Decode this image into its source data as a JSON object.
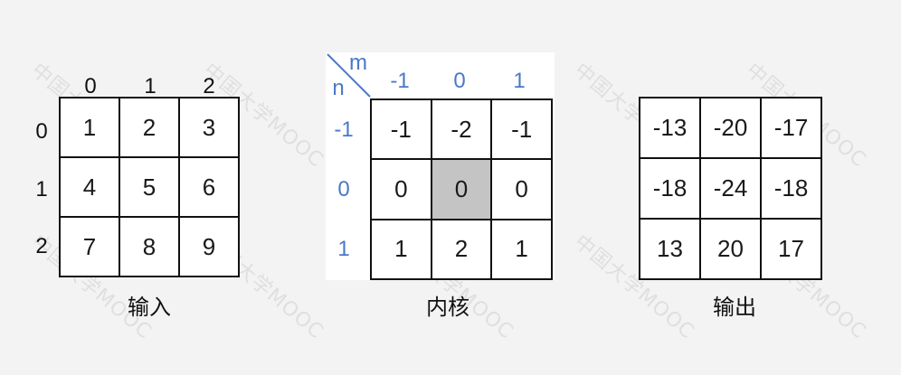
{
  "watermark": "中国大学MOOC",
  "input": {
    "caption": "输入",
    "col_labels": [
      "0",
      "1",
      "2"
    ],
    "row_labels": [
      "0",
      "1",
      "2"
    ],
    "cells": [
      [
        "1",
        "2",
        "3"
      ],
      [
        "4",
        "5",
        "6"
      ],
      [
        "7",
        "8",
        "9"
      ]
    ]
  },
  "kernel": {
    "caption": "内核",
    "axis_m": "m",
    "axis_n": "n",
    "col_labels": [
      "-1",
      "0",
      "1"
    ],
    "row_labels": [
      "-1",
      "0",
      "1"
    ],
    "cells": [
      [
        "-1",
        "-2",
        "-1"
      ],
      [
        "0",
        "0",
        "0"
      ],
      [
        "1",
        "2",
        "1"
      ]
    ],
    "highlight_color": "#c4c4c4",
    "label_color": "#4a78c8"
  },
  "output": {
    "caption": "输出",
    "cells": [
      [
        "-13",
        "-20",
        "-17"
      ],
      [
        "-18",
        "-24",
        "-18"
      ],
      [
        "13",
        "20",
        "17"
      ]
    ]
  }
}
